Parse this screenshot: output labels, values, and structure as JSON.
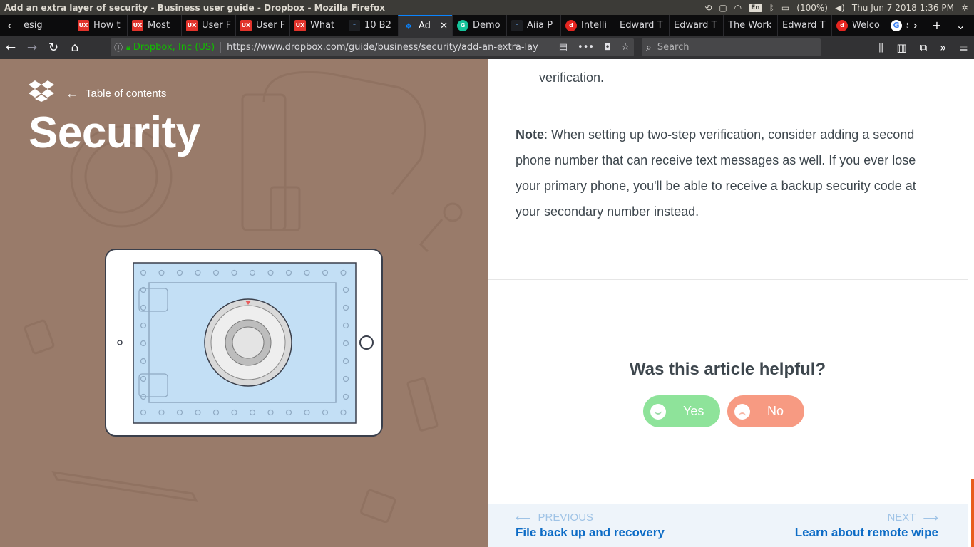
{
  "os": {
    "window_title": "Add an extra layer of security - Business user guide - Dropbox - Mozilla Firefox",
    "battery": "(100%)",
    "clock": "Thu Jun  7 2018  1:36 PM",
    "lang": "En"
  },
  "tabs": [
    {
      "label": "esig",
      "favicon": "none"
    },
    {
      "label": "How t",
      "favicon": "ux"
    },
    {
      "label": "Most",
      "favicon": "ux"
    },
    {
      "label": "User F",
      "favicon": "ux"
    },
    {
      "label": "User F",
      "favicon": "ux"
    },
    {
      "label": "What",
      "favicon": "ux"
    },
    {
      "label": "10 B2",
      "favicon": "dark"
    },
    {
      "label": "Ad",
      "favicon": "dropbox",
      "active": true
    },
    {
      "label": "Demo",
      "favicon": "grammarly"
    },
    {
      "label": "Aiia P",
      "favicon": "dark"
    },
    {
      "label": "Intelli",
      "favicon": "red"
    },
    {
      "label": "Edward T",
      "favicon": "none"
    },
    {
      "label": "Edward T",
      "favicon": "none"
    },
    {
      "label": "The Work",
      "favicon": "none"
    },
    {
      "label": "Edward T",
      "favicon": "none"
    },
    {
      "label": "Welco",
      "favicon": "red"
    },
    {
      "label": "shunt",
      "favicon": "google"
    }
  ],
  "nav": {
    "org": "Dropbox, Inc (US)",
    "url": "https://www.dropbox.com/guide/business/security/add-an-extra-layer-of",
    "search_placeholder": "Search"
  },
  "hero": {
    "toc_label": "Table of contents",
    "title": "Security"
  },
  "article": {
    "cut_line": "verification.",
    "note_label": "Note",
    "note_text": ": When setting up two-step verification, consider adding a second phone number that can receive text messages as well. If you ever lose your primary phone, you'll be able to receive a backup security code at your secondary number instead."
  },
  "feedback": {
    "question": "Was this article helpful?",
    "yes_label": "Yes",
    "no_label": "No"
  },
  "pager": {
    "prev_caption": "PREVIOUS",
    "prev_title": "File back up and recovery",
    "next_caption": "NEXT",
    "next_title": "Learn about remote wipe"
  },
  "colors": {
    "hero_bg": "#997b6a",
    "link": "#0d6cc6",
    "yes": "#8ee39a",
    "no": "#f79a82"
  }
}
